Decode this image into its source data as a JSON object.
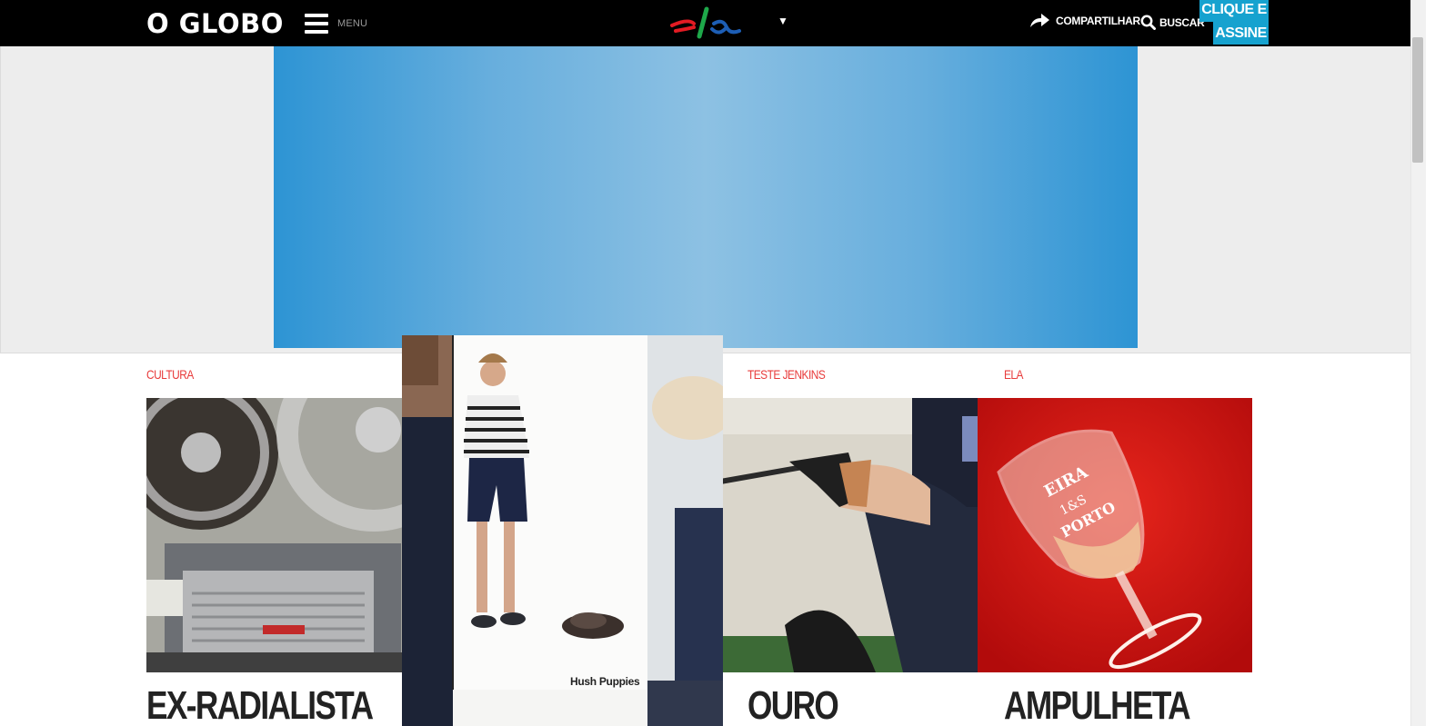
{
  "header": {
    "logo": "O GLOBO",
    "menu_label": "MENU",
    "share_label": "COMPARTILHAR",
    "search_label": "BUSCAR",
    "subscribe_line1": "CLIQUE E",
    "subscribe_line2": "ASSINE",
    "section_logo": "ela",
    "dropdown_glyph": "▼"
  },
  "colors": {
    "topbar": "#000000",
    "section_label": "#e83b3b",
    "subscribe": "#16a2cf",
    "ad_banner": "#2d94d4"
  },
  "articles": [
    {
      "section": "CULTURA",
      "headline": "EX-RADIALISTA",
      "image": "tape-recorder-photo"
    },
    {
      "section": "TESTE JENKINS",
      "headline": "OURO",
      "image": "shooter-photo"
    },
    {
      "section": "ELA",
      "headline": "AMPULHETA",
      "image": "wine-glass-photo"
    }
  ],
  "float_ad": {
    "brand": "Hush Puppies"
  }
}
